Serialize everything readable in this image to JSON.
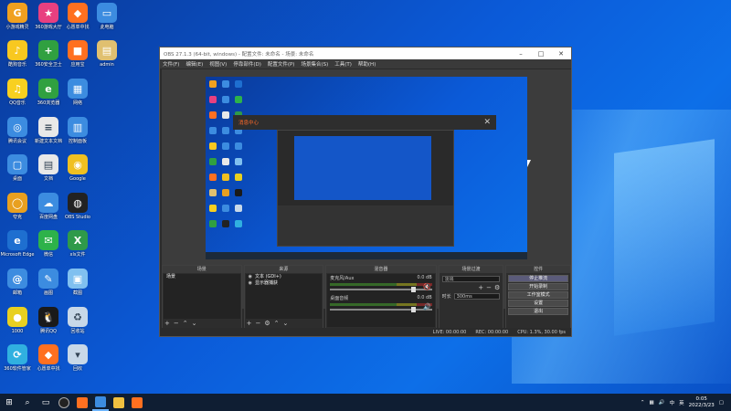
{
  "colors": {
    "desktop_blue": "#0b5ad8",
    "obs_bg": "#2b2b2b",
    "dialog_accent": "#ff6a2a",
    "taskbar": "#0f1e33"
  },
  "desktop_icons": [
    {
      "name": "360-icon",
      "label": "小游戏精灵",
      "color": "#f0a020",
      "glyph": "G"
    },
    {
      "name": "game-icon",
      "label": "360游戏大厅",
      "color": "#e84080",
      "glyph": "★"
    },
    {
      "name": "theme-icon",
      "label": "心愿单中找",
      "color": "#ff7020",
      "glyph": "◆"
    },
    {
      "name": "pc-icon",
      "label": "此电脑",
      "color": "#3c8ce0",
      "glyph": "▭"
    },
    {
      "name": "music-icon",
      "label": "酷狗音乐",
      "color": "#f8c820",
      "glyph": "♪"
    },
    {
      "name": "guard-icon",
      "label": "360安全卫士",
      "color": "#30a040",
      "glyph": "+"
    },
    {
      "name": "app-store-icon",
      "label": "应用宝",
      "color": "#ff7020",
      "glyph": "■"
    },
    {
      "name": "user-folder-icon",
      "label": "admin",
      "color": "#e0c070",
      "glyph": "▤"
    },
    {
      "name": "qqmusic-icon",
      "label": "QQ音乐",
      "color": "#f8d020",
      "glyph": "♫"
    },
    {
      "name": "browser-icon",
      "label": "360浏览器",
      "color": "#30a040",
      "glyph": "e"
    },
    {
      "name": "network-icon",
      "label": "网络",
      "color": "#3c8ce0",
      "glyph": "▦"
    },
    {
      "name": "meeting-icon",
      "label": "腾讯会议",
      "color": "#3c8ce0",
      "glyph": "◎"
    },
    {
      "name": "doc-icon",
      "label": "新建文本文档",
      "color": "#e8e8e8",
      "glyph": "≡"
    },
    {
      "name": "control-icon",
      "label": "控制面板",
      "color": "#3c8ce0",
      "glyph": "▥"
    },
    {
      "name": "folder-icon",
      "label": "桌面",
      "color": "#3c8ce0",
      "glyph": "▢"
    },
    {
      "name": "file-icon",
      "label": "文档",
      "color": "#e8e8e8",
      "glyph": "▤"
    },
    {
      "name": "chrome-icon",
      "label": "Google",
      "color": "#f0c020",
      "glyph": "◉"
    },
    {
      "name": "quark-icon",
      "label": "夸克",
      "color": "#e8a020",
      "glyph": "◯"
    },
    {
      "name": "cloud-icon",
      "label": "百度网盘",
      "color": "#3c8ce0",
      "glyph": "☁"
    },
    {
      "name": "obs-icon",
      "label": "OBS Studio",
      "color": "#222222",
      "glyph": "◍"
    },
    {
      "name": "edge-icon",
      "label": "Microsoft Edge",
      "color": "#1e6fd0",
      "glyph": "e"
    },
    {
      "name": "wechat-icon",
      "label": "微信",
      "color": "#2db24a",
      "glyph": "✉"
    },
    {
      "name": "excel-icon",
      "label": "xls文件",
      "color": "#2f9a4a",
      "glyph": "X"
    },
    {
      "name": "ie-icon",
      "label": "邮箱",
      "color": "#3c8ce0",
      "glyph": "@"
    },
    {
      "name": "paint-icon",
      "label": "画图",
      "color": "#3c8ce0",
      "glyph": "✎"
    },
    {
      "name": "screen-icon",
      "label": "截图",
      "color": "#80c0f0",
      "glyph": "▣"
    },
    {
      "name": "qq-game-icon",
      "label": "1000",
      "color": "#e8d020",
      "glyph": "●"
    },
    {
      "name": "qq-icon",
      "label": "腾讯QQ",
      "color": "#1a1a1a",
      "glyph": "🐧"
    },
    {
      "name": "recycle-icon",
      "label": "回收站",
      "color": "#c8d8e8",
      "glyph": "♻"
    },
    {
      "name": "update-icon",
      "label": "360软件管家",
      "color": "#30b0e0",
      "glyph": "⟳"
    },
    {
      "name": "app-store-2-icon",
      "label": "心愿单中找",
      "color": "#ff7020",
      "glyph": "◆"
    },
    {
      "name": "trash-icon",
      "label": "回收",
      "color": "#c8d8e8",
      "glyph": "▾"
    }
  ],
  "obs": {
    "title": "OBS 27.1.3 (64-bit, windows) - 配置文件: 未命名 - 场景: 未命名",
    "menus": [
      "文件(F)",
      "编辑(E)",
      "视图(V)",
      "停靠部件(D)",
      "配置文件(P)",
      "场景集合(S)",
      "工具(T)",
      "帮助(H)"
    ],
    "nested_dialog_title": "消息中心",
    "docks": {
      "scenes": {
        "header": "场景",
        "items": [
          "场景"
        ]
      },
      "sources": {
        "header": "来源",
        "items": [
          "文本 (GDI+)",
          "显示器捕获"
        ]
      },
      "mixer": {
        "header": "混音器",
        "channels": [
          {
            "name": "麦克风/Aux",
            "level": "0.0 dB"
          },
          {
            "name": "桌面音频",
            "level": "0.0 dB"
          }
        ]
      },
      "transitions": {
        "header": "场景过渡",
        "type": "淡出",
        "duration_label": "时长",
        "duration": "300ms"
      },
      "controls": {
        "header": "控件",
        "buttons": [
          "停止推流",
          "开始录制",
          "工作室模式",
          "设置",
          "退出"
        ]
      }
    },
    "status": {
      "live": "LIVE: 00:00:00",
      "rec": "REC: 00:00:00",
      "cpu": "CPU: 1.3%, 30.00 fps"
    }
  },
  "taskbar": {
    "search_icon": "search-icon",
    "time": "0:05",
    "date": "2022/3/23",
    "ime": "中",
    "lang": "英"
  }
}
